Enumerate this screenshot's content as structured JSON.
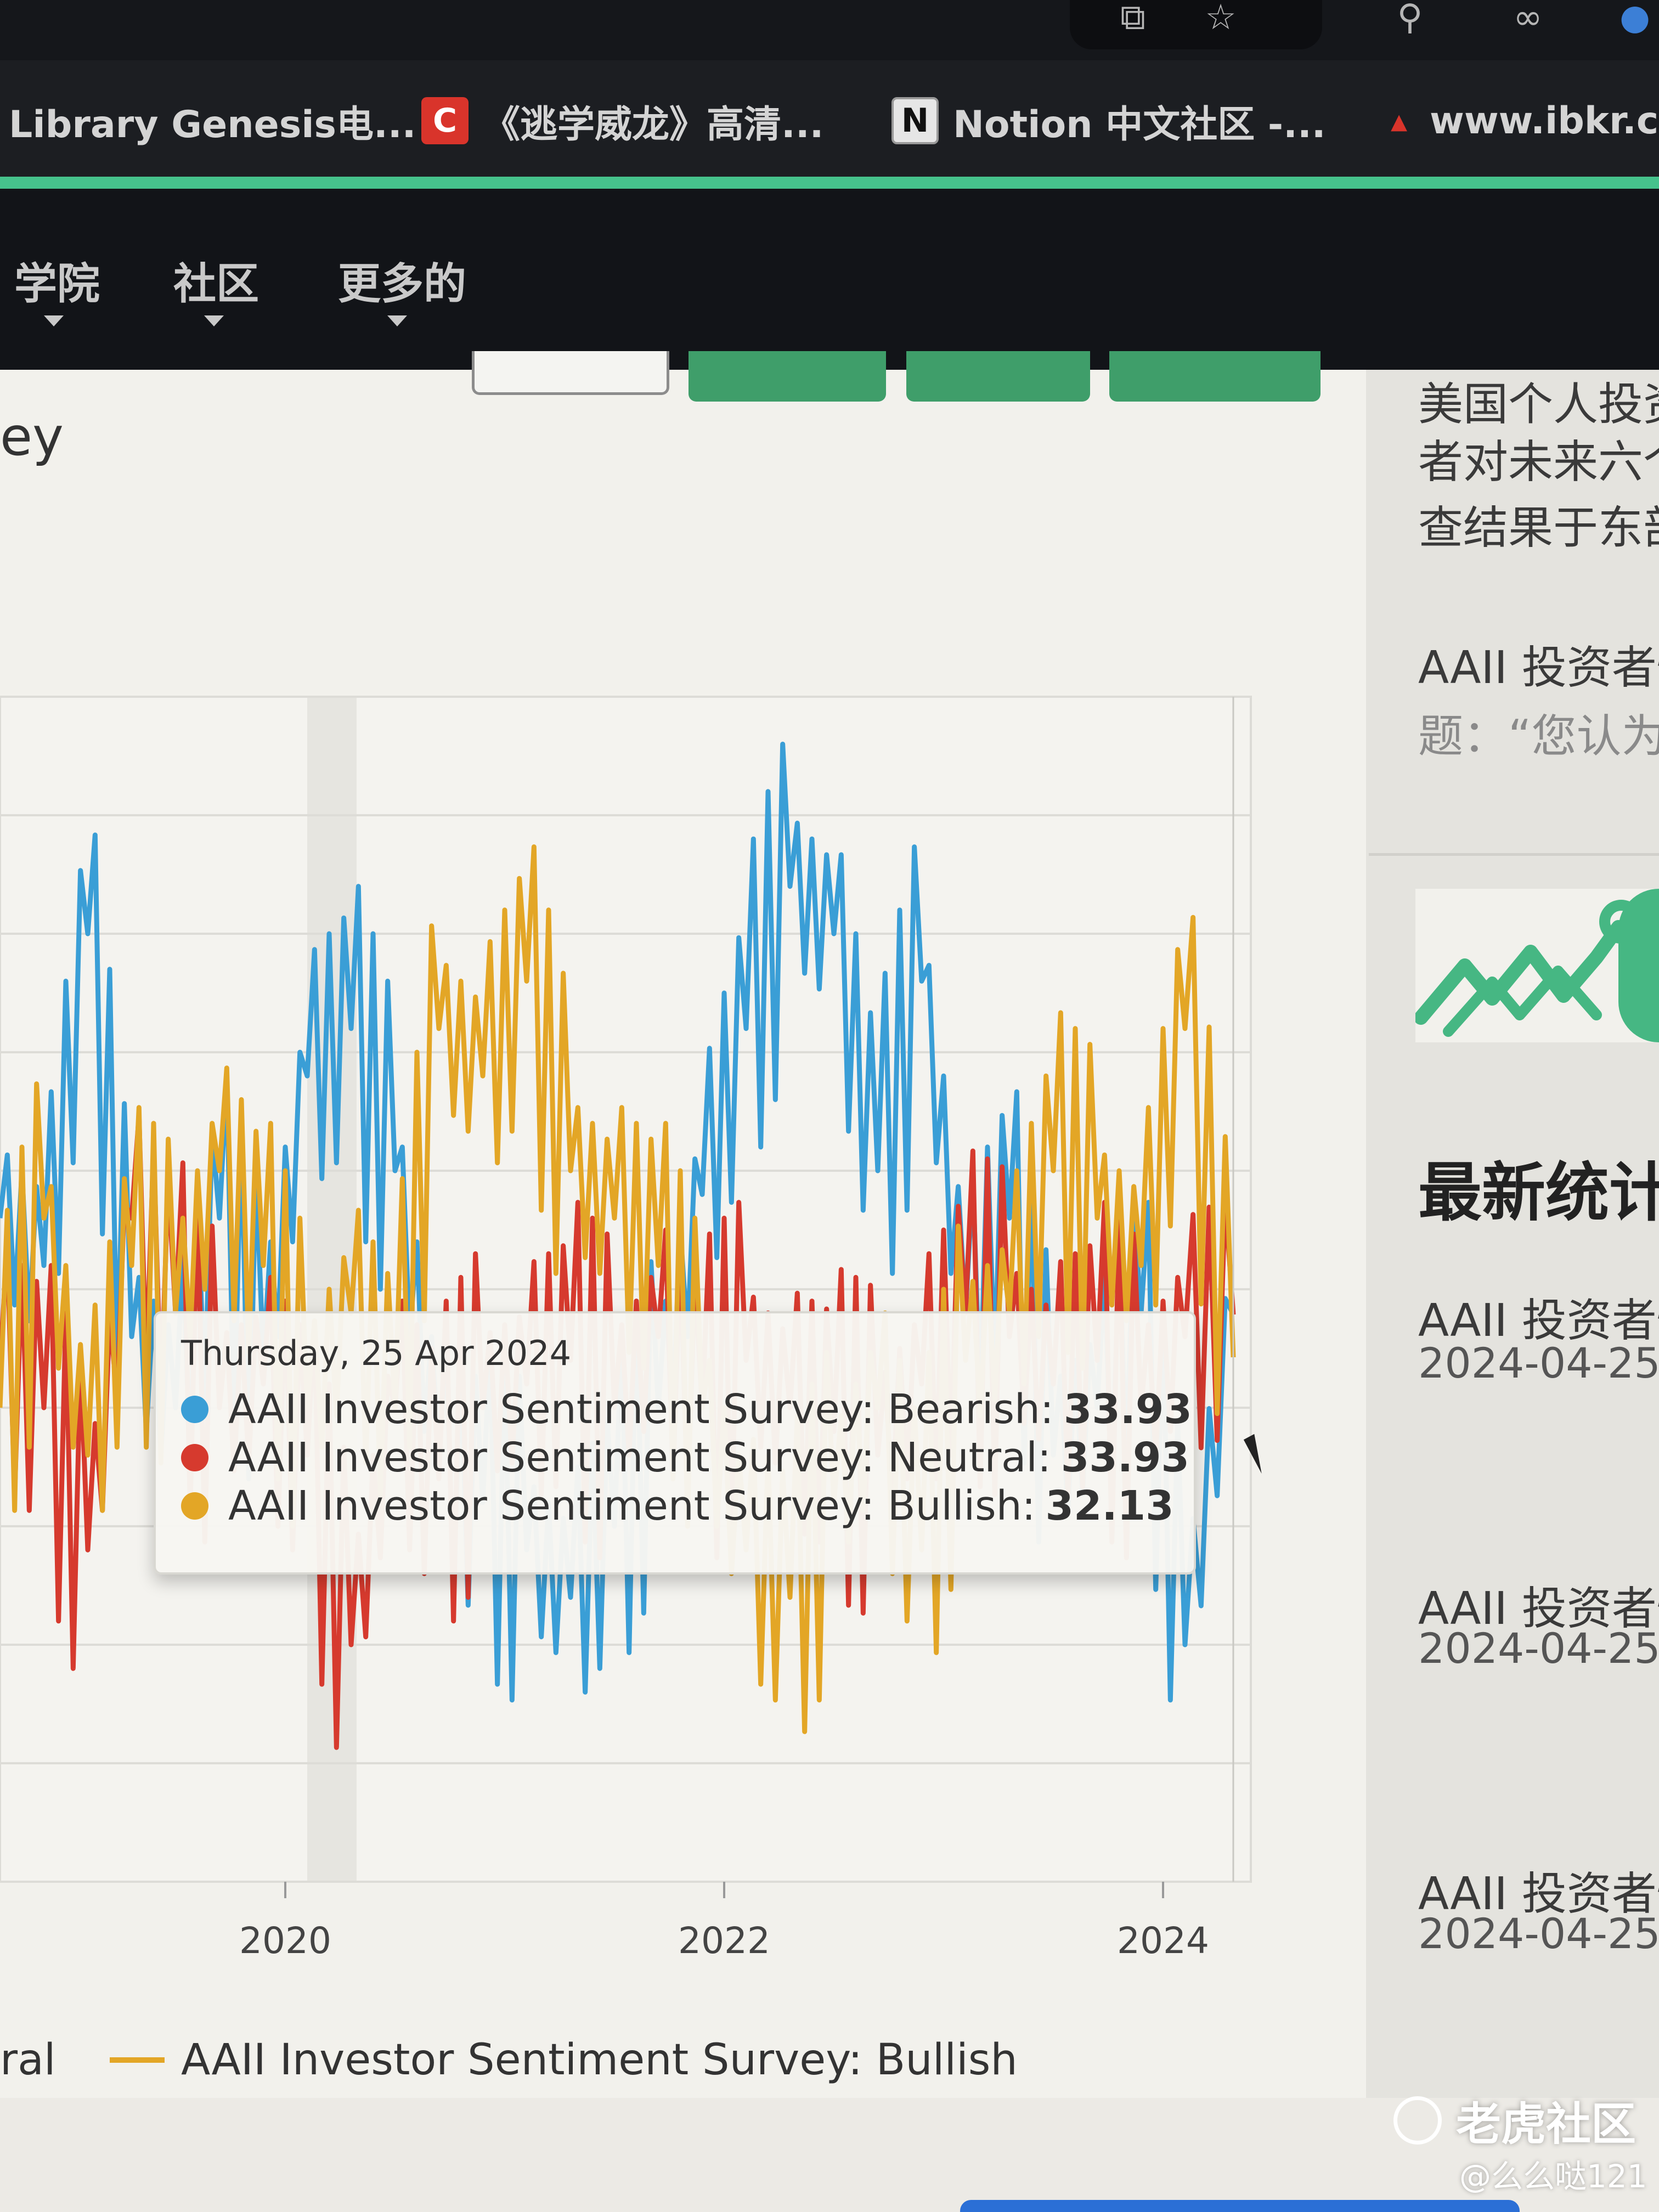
{
  "browser": {
    "bookmarks": [
      {
        "label": "Library Genesis电...",
        "icon": "book-icon",
        "fav_text": "",
        "fav_color": "#1c1e22"
      },
      {
        "label": "《逃学威龙》高清...",
        "icon": "c-logo-icon",
        "fav_text": "C",
        "fav_color": "#d9342b"
      },
      {
        "label": "Notion 中文社区 -...",
        "icon": "notion-icon",
        "fav_text": "N",
        "fav_color": "#e6e6e6"
      },
      {
        "label": "www.ibkr.c",
        "icon": "ibkr-icon",
        "fav_text": "",
        "fav_color": "#1c1e22"
      }
    ]
  },
  "nav": {
    "items": [
      "学院",
      "社区",
      "更多的"
    ]
  },
  "page": {
    "heading_fragment": "ey"
  },
  "chart_data": {
    "type": "line",
    "x_ticks": [
      "2020",
      "2022",
      "2024"
    ],
    "series": [
      {
        "name": "AAII Investor Sentiment Survey: Bearish",
        "color": "#3a9ed6",
        "x": [
          2018.7,
          2018.9,
          2019.1,
          2019.3,
          2019.5,
          2019.7,
          2019.9,
          2020.1,
          2020.3,
          2020.5,
          2020.7,
          2020.9,
          2021.1,
          2021.3,
          2021.5,
          2021.7,
          2021.9,
          2022.1,
          2022.3,
          2022.5,
          2022.7,
          2022.9,
          2023.1,
          2023.3,
          2023.5,
          2023.7,
          2023.9,
          2024.1,
          2024.32
        ],
        "values": [
          38,
          36,
          50,
          33,
          30,
          38,
          32,
          44,
          46,
          40,
          28,
          26,
          24,
          22,
          25,
          30,
          39,
          46,
          52,
          50,
          40,
          48,
          34,
          38,
          28,
          30,
          34,
          20,
          33.93
        ]
      },
      {
        "name": "AAII Investor Sentiment Survey: Neutral",
        "color": "#d63a2e",
        "x": [
          2018.7,
          2018.9,
          2019.1,
          2019.3,
          2019.5,
          2019.7,
          2019.9,
          2020.1,
          2020.3,
          2020.5,
          2020.7,
          2020.9,
          2021.1,
          2021.3,
          2021.5,
          2021.7,
          2021.9,
          2022.1,
          2022.3,
          2022.5,
          2022.7,
          2022.9,
          2023.1,
          2023.3,
          2023.5,
          2023.7,
          2023.9,
          2024.1,
          2024.32
        ],
        "values": [
          32,
          30,
          24,
          38,
          34,
          30,
          31,
          28,
          20,
          30,
          27,
          30,
          31,
          32,
          30,
          33,
          30,
          32,
          30,
          29,
          28,
          31,
          34,
          33,
          31,
          32,
          30,
          33,
          33.93
        ]
      },
      {
        "name": "AAII Investor Sentiment Survey: Bullish",
        "color": "#e3a626",
        "x": [
          2018.7,
          2018.9,
          2019.1,
          2019.3,
          2019.5,
          2019.7,
          2019.9,
          2020.1,
          2020.3,
          2020.5,
          2020.7,
          2020.9,
          2021.1,
          2021.3,
          2021.5,
          2021.7,
          2021.9,
          2022.1,
          2022.3,
          2022.5,
          2022.7,
          2022.9,
          2023.1,
          2023.3,
          2023.5,
          2023.7,
          2023.9,
          2024.1,
          2024.32
        ],
        "values": [
          30,
          38,
          28,
          36,
          34,
          40,
          36,
          30,
          34,
          30,
          46,
          44,
          48,
          40,
          38,
          36,
          30,
          24,
          22,
          26,
          30,
          24,
          32,
          34,
          40,
          38,
          36,
          46,
          32.13
        ]
      }
    ],
    "legend_visible": "AAII Investor Sentiment Survey: Bullish",
    "legend_partial": "ral",
    "tooltip": {
      "date": "Thursday, 25 Apr 2024",
      "rows": [
        {
          "label": "AAII Investor Sentiment Survey: Bearish:",
          "value": "33.93",
          "color": "#3a9ed6"
        },
        {
          "label": "AAII Investor Sentiment Survey: Neutral:",
          "value": "33.93",
          "color": "#d63a2e"
        },
        {
          "label": "AAII Investor Sentiment Survey: Bullish:",
          "value": "32.13",
          "color": "#e3a626"
        }
      ]
    },
    "ylim": [
      10,
      60
    ],
    "xlim": [
      2018.7,
      2024.4
    ],
    "grid": true
  },
  "sidebar": {
    "intro_lines": [
      "美国个人投资",
      "者对未来六个",
      "查结果于东部"
    ],
    "survey_title": "AAII 投资者情",
    "survey_question": "题：“您认为",
    "latest_title": "最新统计",
    "latest_items": [
      {
        "title": "AAII 投资者情",
        "date": "2024-04-25"
      },
      {
        "title": "AAII 投资者情",
        "date": "2024-04-25"
      },
      {
        "title": "AAII 投资者情",
        "date": "2024-04-25"
      }
    ]
  },
  "watermark": {
    "brand": "老虎社区",
    "user": "@么么哒121"
  }
}
